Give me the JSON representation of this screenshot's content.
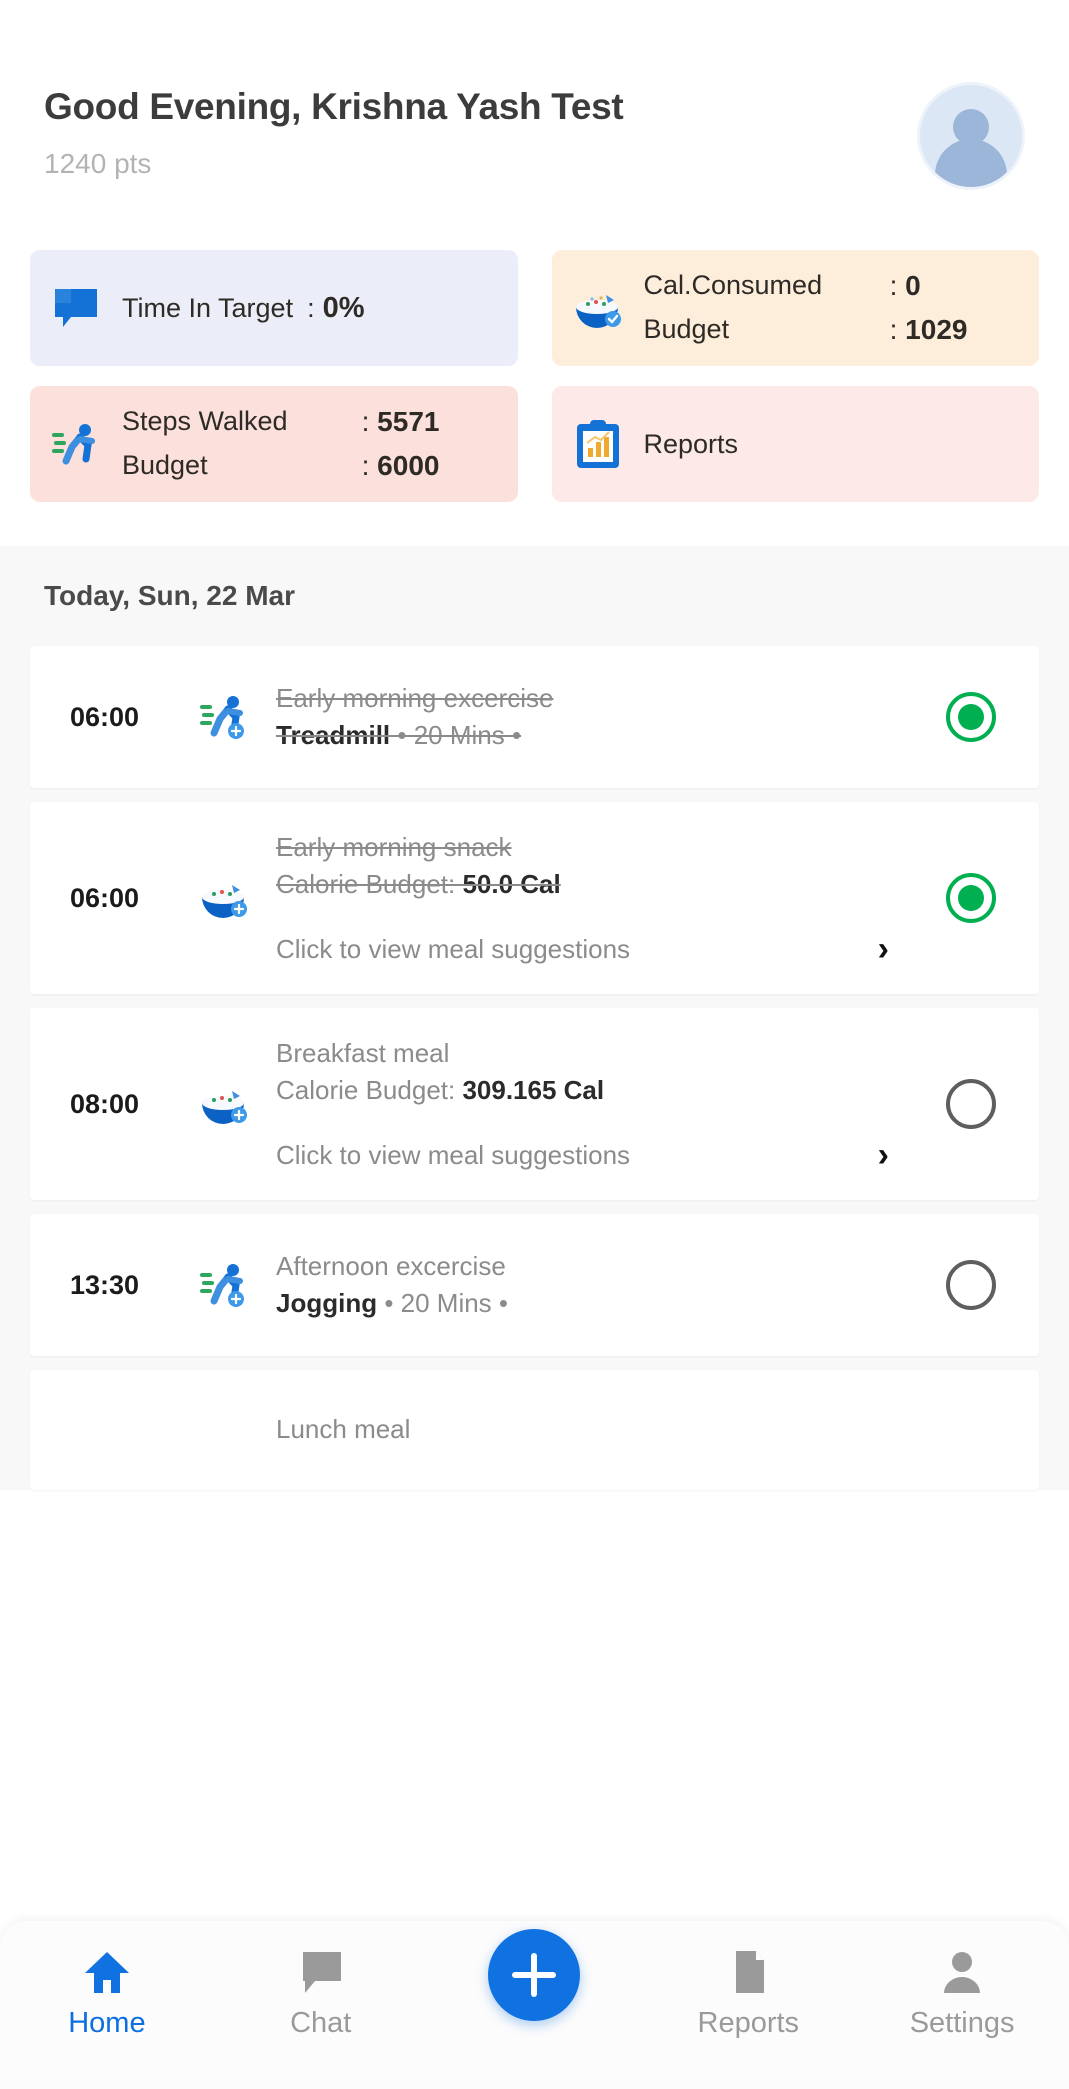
{
  "header": {
    "greeting": "Good Evening, Krishna Yash Test",
    "points": "1240 pts",
    "avatar_alt": "user-avatar"
  },
  "stats": {
    "time_in_target": {
      "label": "Time In Target",
      "colon": ":",
      "value": "0%",
      "icon": "speech-bubble-icon",
      "bg": "#ebedf8"
    },
    "calories": {
      "consumed_label": "Cal.Consumed",
      "consumed_colon": ":",
      "consumed_value": "0",
      "budget_label": "Budget",
      "budget_colon": ":",
      "budget_value": "1029",
      "icon": "rice-bowl-icon",
      "bg": "#fdeedc"
    },
    "steps": {
      "steps_label": "Steps Walked",
      "steps_colon": ":",
      "steps_value": "5571",
      "budget_label": "Budget",
      "budget_colon": ":",
      "budget_value": "6000",
      "icon": "running-person-icon",
      "bg": "#fbe0dc"
    },
    "reports": {
      "label": "Reports",
      "icon": "clipboard-chart-icon",
      "bg": "#fce9e8"
    }
  },
  "timeline": {
    "date_header": "Today, Sun, 22 Mar",
    "items": [
      {
        "time": "06:00",
        "icon": "running-person-icon",
        "title": "Early morning excercise",
        "subtitle_bold": "Treadmill",
        "subtitle_rest": " • 20 Mins •",
        "completed": true,
        "has_link": false,
        "link_text": ""
      },
      {
        "time": "06:00",
        "icon": "rice-bowl-icon",
        "title": "Early morning snack",
        "subtitle_plain": "Calorie Budget: ",
        "subtitle_bold": "50.0 Cal",
        "completed": true,
        "has_link": true,
        "link_text": "Click to view meal suggestions"
      },
      {
        "time": "08:00",
        "icon": "rice-bowl-icon",
        "title": "Breakfast meal",
        "subtitle_plain": "Calorie Budget: ",
        "subtitle_bold": "309.165 Cal",
        "completed": false,
        "has_link": true,
        "link_text": "Click to view meal suggestions"
      },
      {
        "time": "13:30",
        "icon": "running-person-icon",
        "title": "Afternoon excercise",
        "subtitle_bold": "Jogging",
        "subtitle_rest": " • 20 Mins •",
        "completed": false,
        "has_link": false,
        "link_text": ""
      },
      {
        "time": "",
        "icon": "rice-bowl-icon",
        "title": "Lunch meal",
        "subtitle_plain": "",
        "subtitle_bold": "",
        "completed": false,
        "has_link": false,
        "link_text": ""
      }
    ]
  },
  "nav": {
    "items": [
      {
        "label": "Home",
        "icon": "home-icon",
        "active": true
      },
      {
        "label": "Chat",
        "icon": "chat-bubble-icon",
        "active": false
      },
      {
        "label": "Reports",
        "icon": "document-icon",
        "active": false
      },
      {
        "label": "Settings",
        "icon": "person-icon",
        "active": false
      }
    ],
    "fab": {
      "icon": "plus-icon",
      "label": ""
    }
  },
  "colors": {
    "accent_blue": "#1072e0",
    "green_check": "#00b050",
    "lavender": "#ebedf8",
    "cream": "#fdeedc",
    "pink": "#fbe0dc",
    "pink_light": "#fce9e8"
  }
}
